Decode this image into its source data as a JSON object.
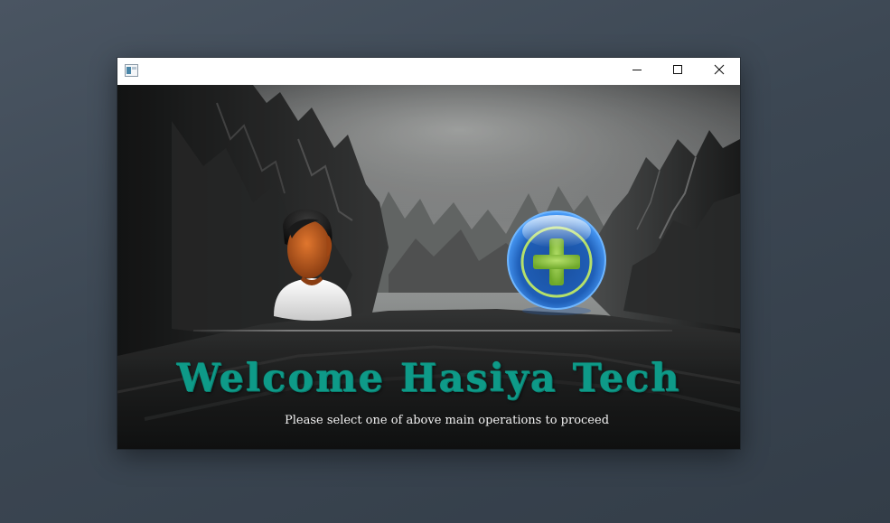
{
  "window": {
    "title": ""
  },
  "titlebar": {
    "app_icon": "app-window-icon",
    "minimize_icon": "minimize-icon",
    "maximize_icon": "maximize-icon",
    "close_icon": "close-icon"
  },
  "main": {
    "welcome_text": "Welcome Hasiya Tech",
    "instruction_text": "Please select one of above main operations to proceed",
    "operations": [
      {
        "icon": "user-icon"
      },
      {
        "icon": "add-plus-icon"
      }
    ]
  },
  "colors": {
    "desktop_background": "#3c4753",
    "welcome_text": "#0e9a88",
    "instruction_text": "#f2f2f2",
    "add_button_blue": "#1f5fb8",
    "add_button_plus": "#8cc63f"
  }
}
